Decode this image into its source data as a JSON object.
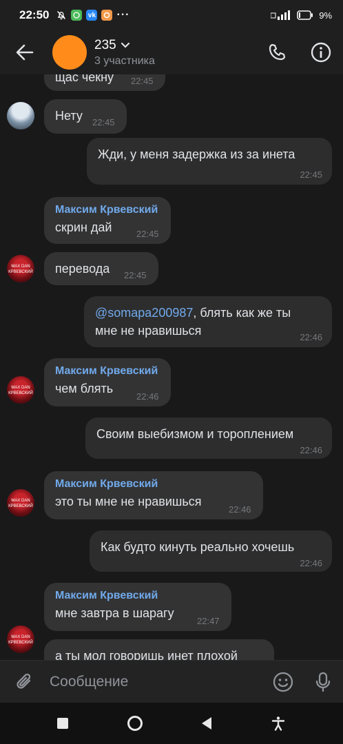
{
  "status_bar": {
    "time": "22:50",
    "battery": "9",
    "battery_unit": "%",
    "icons": [
      "mute-icon",
      "chat-app-icon",
      "vk-icon",
      "ok-icon",
      "more-icon"
    ]
  },
  "header": {
    "title": "235",
    "subtitle": "3 участника",
    "avatar_color": "#ff8c1a"
  },
  "messages": [
    {
      "dir": "in",
      "text": "щас чекну",
      "time": "22:45"
    },
    {
      "dir": "in",
      "text": "Нету",
      "time": "22:45"
    },
    {
      "dir": "out",
      "text": "Жди, у меня задержка из за инета",
      "time": "22:45"
    },
    {
      "dir": "in",
      "sender": "Максим Крвевский",
      "text": "скрин дай",
      "time": "22:45"
    },
    {
      "dir": "in",
      "text": "перевода",
      "time": "22:45"
    },
    {
      "dir": "out",
      "mention": "@somapa200987",
      "text": ",  блять как же ты",
      "text2": "мне не нравишься",
      "time": "22:46"
    },
    {
      "dir": "in",
      "sender": "Максим Крвевский",
      "text": "чем блять",
      "time": "22:46"
    },
    {
      "dir": "out",
      "text": "Своим выебизмом и тороплением",
      "time": "22:46"
    },
    {
      "dir": "in",
      "sender": "Максим Крвевский",
      "text": "это ты мне не нравишься",
      "time": "22:46"
    },
    {
      "dir": "out",
      "text": "Как будто кинуть реально хочешь",
      "time": "22:46"
    },
    {
      "dir": "in",
      "sender": "Максим Крвевский",
      "text": "мне завтра в шарагу",
      "time": "22:47"
    },
    {
      "dir": "in",
      "text": "а ты мол говоришь инет плохой",
      "time": ""
    }
  ],
  "composer": {
    "placeholder": "Сообщение"
  },
  "colors": {
    "background": "#19191a",
    "bubble_in": "#333334",
    "bubble_out": "#2d2d2e",
    "sender_name": "#71aaeb",
    "mention": "#71aaeb"
  }
}
